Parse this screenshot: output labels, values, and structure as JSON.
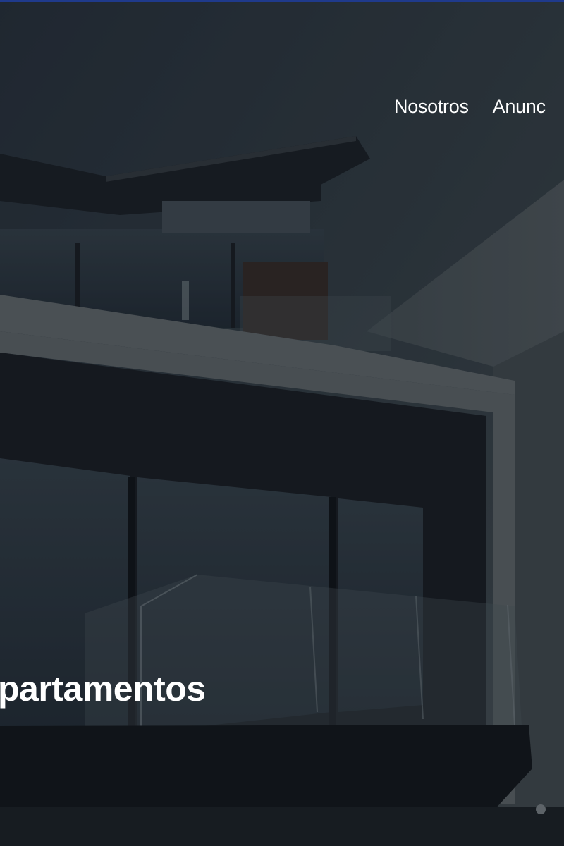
{
  "nav": {
    "items": [
      {
        "label": "Nosotros"
      },
      {
        "label": "Anunc"
      }
    ]
  },
  "hero": {
    "title": "partamentos"
  },
  "colors": {
    "top_rule": "#1f3a8c",
    "sky": "#3d474e",
    "text": "#ffffff"
  }
}
